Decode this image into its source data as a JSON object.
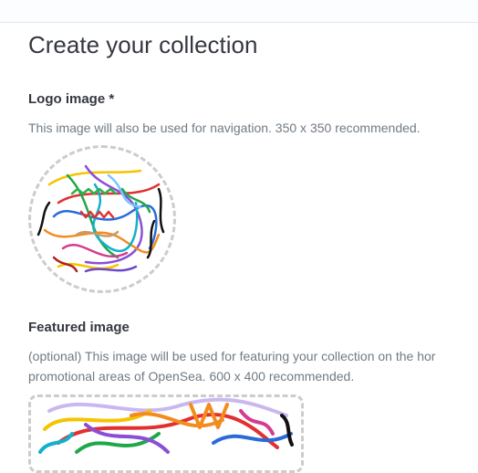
{
  "page": {
    "title": "Create your collection"
  },
  "logo": {
    "label": "Logo image *",
    "description": "This image will also be used for navigation. 350 x 350 recommended.",
    "image": "scribble-artwork"
  },
  "featured": {
    "label": "Featured image",
    "description_line1": "(optional) This image will be used for featuring your collection on the hor",
    "description_line2": "promotional areas of OpenSea. 600 x 400 recommended.",
    "image": "scribble-artwork"
  },
  "colors": {
    "text": "#353840",
    "muted": "#707a83",
    "dashed_border": "#cccccc"
  }
}
